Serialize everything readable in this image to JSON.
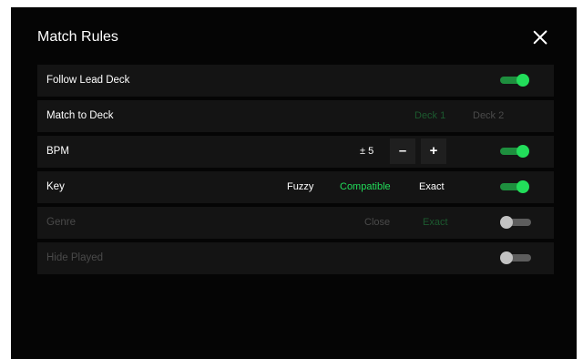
{
  "dialog": {
    "title": "Match Rules",
    "close_icon": "close-icon"
  },
  "colors": {
    "accent": "#22dd5a",
    "accent_dim": "#1e5f33",
    "row_bg": "#141414"
  },
  "rows": {
    "follow_lead_deck": {
      "label": "Follow Lead Deck",
      "toggle_on": true
    },
    "match_to_deck": {
      "label": "Match to Deck",
      "options": [
        "Deck 1",
        "Deck 2"
      ],
      "selected": "Deck 1",
      "enabled": false
    },
    "bpm": {
      "label": "BPM",
      "range": "± 5",
      "minus": "–",
      "plus": "+",
      "toggle_on": true
    },
    "key": {
      "label": "Key",
      "options": [
        "Fuzzy",
        "Compatible",
        "Exact"
      ],
      "selected": "Compatible",
      "toggle_on": true
    },
    "genre": {
      "label": "Genre",
      "options": [
        "Close",
        "Exact"
      ],
      "selected": "Exact",
      "toggle_on": false,
      "enabled": false
    },
    "hide_played": {
      "label": "Hide Played",
      "toggle_on": false,
      "enabled": false
    }
  }
}
